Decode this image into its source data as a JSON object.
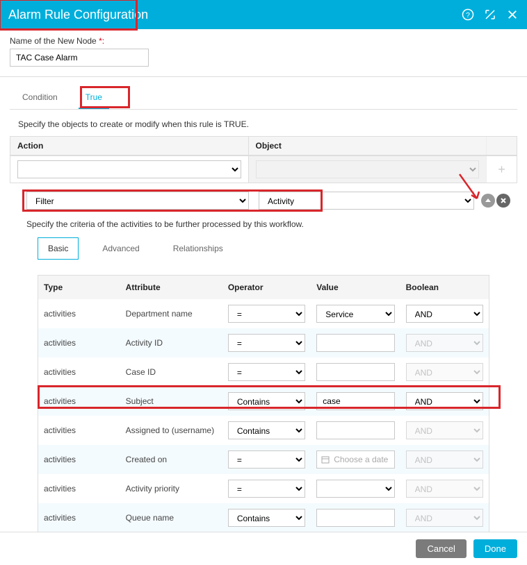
{
  "titlebar": {
    "title": "Alarm Rule Configuration"
  },
  "node_name": {
    "label": "Name of the New Node",
    "required_marker": "*:",
    "value": "TAC Case Alarm"
  },
  "tabs": [
    {
      "label": "Condition",
      "active": false
    },
    {
      "label": "True",
      "active": true
    }
  ],
  "section1_text": "Specify the objects to create or modify when this rule is TRUE.",
  "action_object": {
    "action_header": "Action",
    "object_header": "Object",
    "action_value": "",
    "object_value": ""
  },
  "filter_row": {
    "action_value": "Filter",
    "object_value": "Activity"
  },
  "criteria_text": "Specify the criteria of the activities to be further processed by this workflow.",
  "subtabs": [
    {
      "label": "Basic",
      "active": true
    },
    {
      "label": "Advanced",
      "active": false
    },
    {
      "label": "Relationships",
      "active": false
    }
  ],
  "table": {
    "headers": {
      "type": "Type",
      "attribute": "Attribute",
      "operator": "Operator",
      "value": "Value",
      "boolean": "Boolean"
    },
    "rows": [
      {
        "type": "activities",
        "attribute": "Department name",
        "operator": "=",
        "value": "Service",
        "value_kind": "select",
        "boolean": "AND",
        "boolean_disabled": false
      },
      {
        "type": "activities",
        "attribute": "Activity ID",
        "operator": "=",
        "value": "",
        "value_kind": "text",
        "boolean": "AND",
        "boolean_disabled": true
      },
      {
        "type": "activities",
        "attribute": "Case ID",
        "operator": "=",
        "value": "",
        "value_kind": "text",
        "boolean": "AND",
        "boolean_disabled": true
      },
      {
        "type": "activities",
        "attribute": "Subject",
        "operator": "Contains",
        "value": "case",
        "value_kind": "text",
        "boolean": "AND",
        "boolean_disabled": false
      },
      {
        "type": "activities",
        "attribute": "Assigned to (username)",
        "operator": "Contains",
        "value": "",
        "value_kind": "text",
        "boolean": "AND",
        "boolean_disabled": true
      },
      {
        "type": "activities",
        "attribute": "Created on",
        "operator": "=",
        "value": "Choose a date",
        "value_kind": "date",
        "boolean": "AND",
        "boolean_disabled": true
      },
      {
        "type": "activities",
        "attribute": "Activity priority",
        "operator": "=",
        "value": "",
        "value_kind": "select",
        "boolean": "AND",
        "boolean_disabled": true
      },
      {
        "type": "activities",
        "attribute": "Queue name",
        "operator": "Contains",
        "value": "",
        "value_kind": "text",
        "boolean": "AND",
        "boolean_disabled": true
      }
    ]
  },
  "footer": {
    "cancel": "Cancel",
    "done": "Done"
  }
}
